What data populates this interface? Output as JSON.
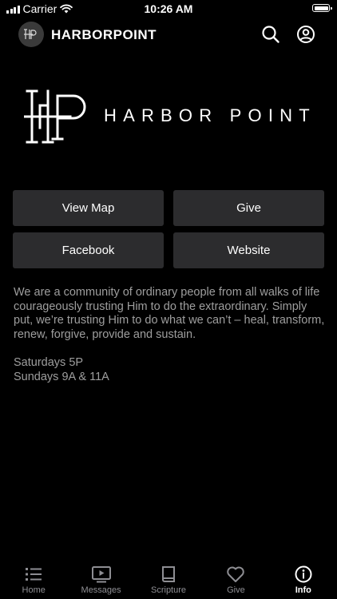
{
  "status_bar": {
    "carrier": "Carrier",
    "time": "10:26 AM"
  },
  "header": {
    "title": "HARBORPOINT",
    "logo_text": "HARBOR POINT"
  },
  "buttons": [
    {
      "label": "View Map"
    },
    {
      "label": "Give"
    },
    {
      "label": "Facebook"
    },
    {
      "label": "Website"
    }
  ],
  "about": {
    "description": "We are a community of ordinary people from all walks of life courageously trusting Him to do the extraordinary. Simply put, we’re trusting Him to do what we can’t – heal, transform, renew, forgive, provide and sustain.",
    "service_times": [
      "Saturdays 5P",
      "Sundays 9A & 11A"
    ]
  },
  "tabs": [
    {
      "label": "Home",
      "icon": "list-icon"
    },
    {
      "label": "Messages",
      "icon": "play-icon"
    },
    {
      "label": "Scripture",
      "icon": "book-icon"
    },
    {
      "label": "Give",
      "icon": "heart-icon"
    },
    {
      "label": "Info",
      "icon": "info-icon",
      "active": true
    }
  ],
  "colors": {
    "background": "#000000",
    "button": "#2c2c2e",
    "text_muted": "#9e9e9e",
    "tab_inactive": "#8e8e93"
  }
}
